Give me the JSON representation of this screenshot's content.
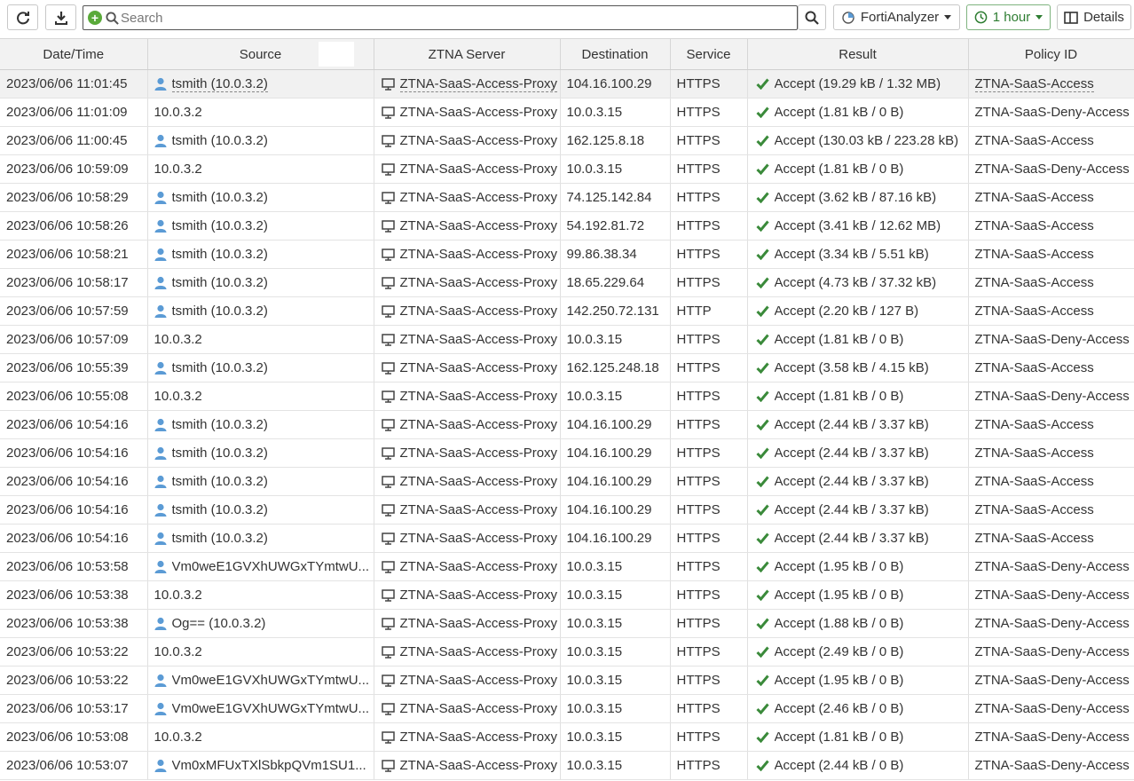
{
  "toolbar": {
    "search_placeholder": "Search",
    "source_label": "FortiAnalyzer",
    "time_label": "1 hour",
    "details_label": "Details"
  },
  "colors": {
    "accept_green": "#3a8a3a",
    "user_blue": "#5b9bd5",
    "time_button_green": "#2e7d32",
    "plus_green": "#5aaa3a"
  },
  "columns": [
    "Date/Time",
    "Source",
    "ZTNA Server",
    "Destination",
    "Service",
    "Result",
    "Policy ID"
  ],
  "rows": [
    {
      "time": "2023/06/06 11:01:45",
      "user": true,
      "source": "tsmith (10.0.3.2)",
      "server": "ZTNA-SaaS-Access-Proxy",
      "dest": "104.16.100.29",
      "service": "HTTPS",
      "result": "Accept (19.29 kB / 1.32 MB)",
      "policy": "ZTNA-SaaS-Access",
      "selected": true
    },
    {
      "time": "2023/06/06 11:01:09",
      "user": false,
      "source": "10.0.3.2",
      "server": "ZTNA-SaaS-Access-Proxy",
      "dest": "10.0.3.15",
      "service": "HTTPS",
      "result": "Accept (1.81 kB / 0 B)",
      "policy": "ZTNA-SaaS-Deny-Access"
    },
    {
      "time": "2023/06/06 11:00:45",
      "user": true,
      "source": "tsmith (10.0.3.2)",
      "server": "ZTNA-SaaS-Access-Proxy",
      "dest": "162.125.8.18",
      "service": "HTTPS",
      "result": "Accept (130.03 kB / 223.28 kB)",
      "policy": "ZTNA-SaaS-Access"
    },
    {
      "time": "2023/06/06 10:59:09",
      "user": false,
      "source": "10.0.3.2",
      "server": "ZTNA-SaaS-Access-Proxy",
      "dest": "10.0.3.15",
      "service": "HTTPS",
      "result": "Accept (1.81 kB / 0 B)",
      "policy": "ZTNA-SaaS-Deny-Access"
    },
    {
      "time": "2023/06/06 10:58:29",
      "user": true,
      "source": "tsmith (10.0.3.2)",
      "server": "ZTNA-SaaS-Access-Proxy",
      "dest": "74.125.142.84",
      "service": "HTTPS",
      "result": "Accept (3.62 kB / 87.16 kB)",
      "policy": "ZTNA-SaaS-Access"
    },
    {
      "time": "2023/06/06 10:58:26",
      "user": true,
      "source": "tsmith (10.0.3.2)",
      "server": "ZTNA-SaaS-Access-Proxy",
      "dest": "54.192.81.72",
      "service": "HTTPS",
      "result": "Accept (3.41 kB / 12.62 MB)",
      "policy": "ZTNA-SaaS-Access"
    },
    {
      "time": "2023/06/06 10:58:21",
      "user": true,
      "source": "tsmith (10.0.3.2)",
      "server": "ZTNA-SaaS-Access-Proxy",
      "dest": "99.86.38.34",
      "service": "HTTPS",
      "result": "Accept (3.34 kB / 5.51 kB)",
      "policy": "ZTNA-SaaS-Access"
    },
    {
      "time": "2023/06/06 10:58:17",
      "user": true,
      "source": "tsmith (10.0.3.2)",
      "server": "ZTNA-SaaS-Access-Proxy",
      "dest": "18.65.229.64",
      "service": "HTTPS",
      "result": "Accept (4.73 kB / 37.32 kB)",
      "policy": "ZTNA-SaaS-Access"
    },
    {
      "time": "2023/06/06 10:57:59",
      "user": true,
      "source": "tsmith (10.0.3.2)",
      "server": "ZTNA-SaaS-Access-Proxy",
      "dest": "142.250.72.131",
      "service": "HTTP",
      "result": "Accept (2.20 kB / 127 B)",
      "policy": "ZTNA-SaaS-Access"
    },
    {
      "time": "2023/06/06 10:57:09",
      "user": false,
      "source": "10.0.3.2",
      "server": "ZTNA-SaaS-Access-Proxy",
      "dest": "10.0.3.15",
      "service": "HTTPS",
      "result": "Accept (1.81 kB / 0 B)",
      "policy": "ZTNA-SaaS-Deny-Access"
    },
    {
      "time": "2023/06/06 10:55:39",
      "user": true,
      "source": "tsmith (10.0.3.2)",
      "server": "ZTNA-SaaS-Access-Proxy",
      "dest": "162.125.248.18",
      "service": "HTTPS",
      "result": "Accept (3.58 kB / 4.15 kB)",
      "policy": "ZTNA-SaaS-Access"
    },
    {
      "time": "2023/06/06 10:55:08",
      "user": false,
      "source": "10.0.3.2",
      "server": "ZTNA-SaaS-Access-Proxy",
      "dest": "10.0.3.15",
      "service": "HTTPS",
      "result": "Accept (1.81 kB / 0 B)",
      "policy": "ZTNA-SaaS-Deny-Access"
    },
    {
      "time": "2023/06/06 10:54:16",
      "user": true,
      "source": "tsmith (10.0.3.2)",
      "server": "ZTNA-SaaS-Access-Proxy",
      "dest": "104.16.100.29",
      "service": "HTTPS",
      "result": "Accept (2.44 kB / 3.37 kB)",
      "policy": "ZTNA-SaaS-Access"
    },
    {
      "time": "2023/06/06 10:54:16",
      "user": true,
      "source": "tsmith (10.0.3.2)",
      "server": "ZTNA-SaaS-Access-Proxy",
      "dest": "104.16.100.29",
      "service": "HTTPS",
      "result": "Accept (2.44 kB / 3.37 kB)",
      "policy": "ZTNA-SaaS-Access"
    },
    {
      "time": "2023/06/06 10:54:16",
      "user": true,
      "source": "tsmith (10.0.3.2)",
      "server": "ZTNA-SaaS-Access-Proxy",
      "dest": "104.16.100.29",
      "service": "HTTPS",
      "result": "Accept (2.44 kB / 3.37 kB)",
      "policy": "ZTNA-SaaS-Access"
    },
    {
      "time": "2023/06/06 10:54:16",
      "user": true,
      "source": "tsmith (10.0.3.2)",
      "server": "ZTNA-SaaS-Access-Proxy",
      "dest": "104.16.100.29",
      "service": "HTTPS",
      "result": "Accept (2.44 kB / 3.37 kB)",
      "policy": "ZTNA-SaaS-Access"
    },
    {
      "time": "2023/06/06 10:54:16",
      "user": true,
      "source": "tsmith (10.0.3.2)",
      "server": "ZTNA-SaaS-Access-Proxy",
      "dest": "104.16.100.29",
      "service": "HTTPS",
      "result": "Accept (2.44 kB / 3.37 kB)",
      "policy": "ZTNA-SaaS-Access"
    },
    {
      "time": "2023/06/06 10:53:58",
      "user": true,
      "source": "Vm0weE1GVXhUWGxTYmtwU...",
      "server": "ZTNA-SaaS-Access-Proxy",
      "dest": "10.0.3.15",
      "service": "HTTPS",
      "result": "Accept (1.95 kB / 0 B)",
      "policy": "ZTNA-SaaS-Deny-Access"
    },
    {
      "time": "2023/06/06 10:53:38",
      "user": false,
      "source": "10.0.3.2",
      "server": "ZTNA-SaaS-Access-Proxy",
      "dest": "10.0.3.15",
      "service": "HTTPS",
      "result": "Accept (1.95 kB / 0 B)",
      "policy": "ZTNA-SaaS-Deny-Access"
    },
    {
      "time": "2023/06/06 10:53:38",
      "user": true,
      "source": "Og== (10.0.3.2)",
      "server": "ZTNA-SaaS-Access-Proxy",
      "dest": "10.0.3.15",
      "service": "HTTPS",
      "result": "Accept (1.88 kB / 0 B)",
      "policy": "ZTNA-SaaS-Deny-Access"
    },
    {
      "time": "2023/06/06 10:53:22",
      "user": false,
      "source": "10.0.3.2",
      "server": "ZTNA-SaaS-Access-Proxy",
      "dest": "10.0.3.15",
      "service": "HTTPS",
      "result": "Accept (2.49 kB / 0 B)",
      "policy": "ZTNA-SaaS-Deny-Access"
    },
    {
      "time": "2023/06/06 10:53:22",
      "user": true,
      "source": "Vm0weE1GVXhUWGxTYmtwU...",
      "server": "ZTNA-SaaS-Access-Proxy",
      "dest": "10.0.3.15",
      "service": "HTTPS",
      "result": "Accept (1.95 kB / 0 B)",
      "policy": "ZTNA-SaaS-Deny-Access"
    },
    {
      "time": "2023/06/06 10:53:17",
      "user": true,
      "source": "Vm0weE1GVXhUWGxTYmtwU...",
      "server": "ZTNA-SaaS-Access-Proxy",
      "dest": "10.0.3.15",
      "service": "HTTPS",
      "result": "Accept (2.46 kB / 0 B)",
      "policy": "ZTNA-SaaS-Deny-Access"
    },
    {
      "time": "2023/06/06 10:53:08",
      "user": false,
      "source": "10.0.3.2",
      "server": "ZTNA-SaaS-Access-Proxy",
      "dest": "10.0.3.15",
      "service": "HTTPS",
      "result": "Accept (1.81 kB / 0 B)",
      "policy": "ZTNA-SaaS-Deny-Access"
    },
    {
      "time": "2023/06/06 10:53:07",
      "user": true,
      "source": "Vm0xMFUxTXlSbkpQVm1SU1...",
      "server": "ZTNA-SaaS-Access-Proxy",
      "dest": "10.0.3.15",
      "service": "HTTPS",
      "result": "Accept (2.44 kB / 0 B)",
      "policy": "ZTNA-SaaS-Deny-Access"
    }
  ]
}
